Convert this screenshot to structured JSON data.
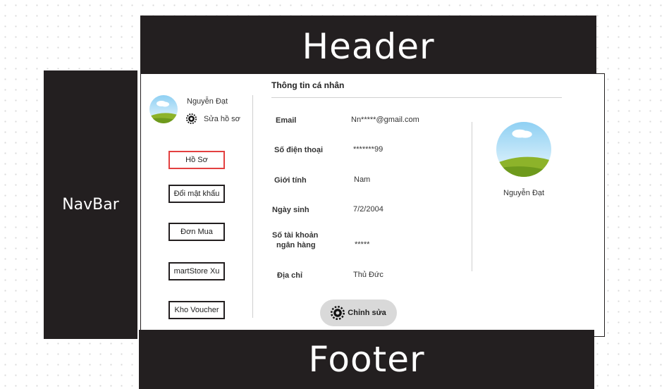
{
  "header": {
    "label": "Header"
  },
  "navbar": {
    "label": "NavBar"
  },
  "footer": {
    "label": "Footer"
  },
  "profile": {
    "name": "Nguyễn Đạt",
    "edit_profile_label": "Sửa hồ sơ"
  },
  "sidebar": {
    "items": [
      {
        "label": "Hồ Sơ",
        "active": true
      },
      {
        "label": "Đổi mật khẩu",
        "active": false
      },
      {
        "label": "Đơn Mua",
        "active": false
      },
      {
        "label": "martStore Xu",
        "active": false
      },
      {
        "label": "Kho Voucher",
        "active": false
      }
    ]
  },
  "info": {
    "title": "Thông tin  cá  nhân",
    "fields": [
      {
        "label": "Email",
        "value": "Nn*****@gmail.com"
      },
      {
        "label": "Số điện thoại",
        "value": "*******99"
      },
      {
        "label": "Giới tính",
        "value": "Nam"
      },
      {
        "label": "Ngày sinh",
        "value": "7/2/2004"
      },
      {
        "label_line1": "Số tài  khoản",
        "label_line2": "ngân hàng",
        "value": "*****"
      },
      {
        "label": "Địa chỉ",
        "value": "Thủ Đức"
      }
    ],
    "edit_button": "Chỉnh sửa"
  },
  "colors": {
    "dark_block": "#231f20",
    "active_border": "#e34040",
    "edit_button_bg": "#d9d9d9"
  },
  "icons": {
    "avatar": "avatar-landscape-icon",
    "settings": "gear-icon"
  }
}
